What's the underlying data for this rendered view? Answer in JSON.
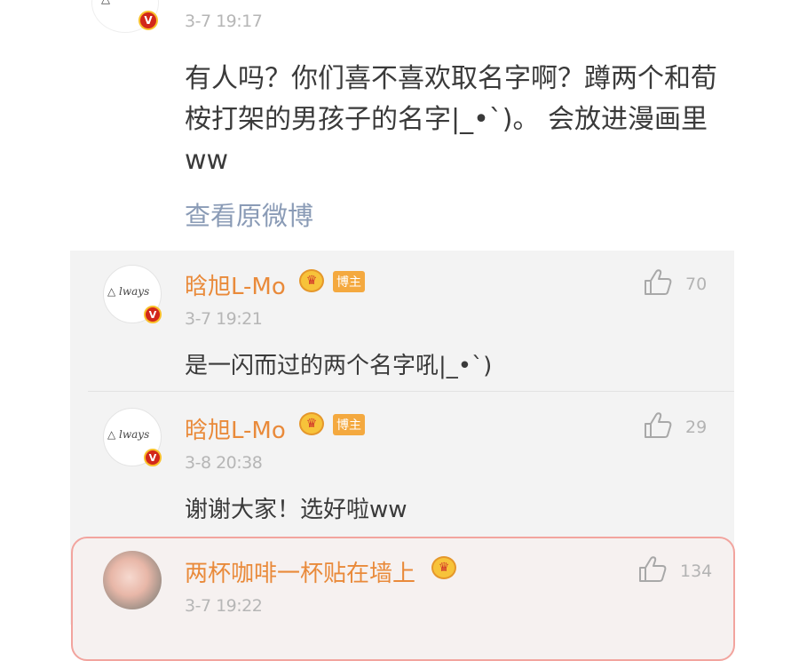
{
  "post": {
    "time": "3-7  19:17",
    "text": "有人吗？你们喜不喜欢取名字啊？蹲两个和荀桉打架的男孩子的名字|_•`)。 会放进漫画里ww",
    "view_original": "查看原微博"
  },
  "comments": [
    {
      "username": "晗旭L-Mo",
      "badge": "博主",
      "time": "3-7  19:21",
      "text": "是一闪而过的两个名字吼|_•`)",
      "likes": "70"
    },
    {
      "username": "晗旭L-Mo",
      "badge": "博主",
      "time": "3-8  20:38",
      "text": "谢谢大家！选好啦ww",
      "likes": "29"
    },
    {
      "username": "两杯咖啡一杯贴在墙上",
      "time": "3-7  19:22",
      "likes": "134"
    }
  ],
  "icons": {
    "verified": "verified-badge-icon",
    "crown": "crown-icon",
    "like": "thumbs-up-icon"
  },
  "colors": {
    "username": "#e98a3a",
    "link": "#8a9bb6",
    "panel_bg": "#f3f3f3",
    "highlight_border": "#f2a49e"
  }
}
